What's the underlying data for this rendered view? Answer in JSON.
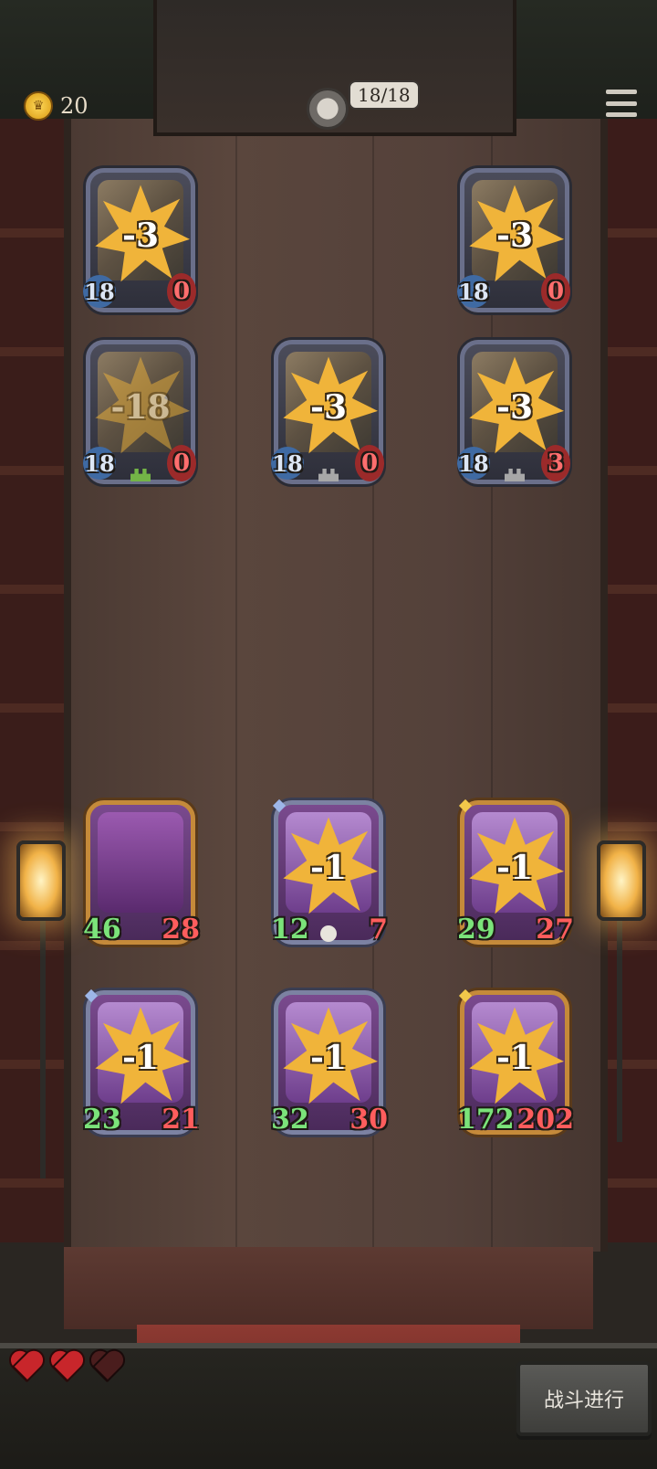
{
  "hud": {
    "gold": "20",
    "turn_counter": "18/18",
    "lives_total": 3,
    "lives_remaining": 2
  },
  "enemy_cards": [
    {
      "attack": "18",
      "health": "0",
      "damage": "-3",
      "faded": false
    },
    {
      "attack": "18",
      "health": "0",
      "damage": "-3",
      "faded": false
    },
    {
      "attack": "18",
      "health": "0",
      "damage": "-18",
      "faded": true
    },
    {
      "attack": "18",
      "health": "0",
      "damage": "-3",
      "faded": false
    },
    {
      "attack": "18",
      "health": "3",
      "damage": "-3",
      "faded": false
    }
  ],
  "ally_cards": [
    {
      "attack": "46",
      "health": "28",
      "damage": ""
    },
    {
      "attack": "12",
      "health": "7",
      "damage": "-1"
    },
    {
      "attack": "29",
      "health": "27",
      "damage": "-1"
    },
    {
      "attack": "23",
      "health": "21",
      "damage": "-1"
    },
    {
      "attack": "32",
      "health": "30",
      "damage": "-1"
    },
    {
      "attack": "172",
      "health": "202",
      "damage": "-1"
    }
  ],
  "battle_button_label": "战斗进行",
  "icons": {
    "gold": "crown-coin-icon",
    "menu": "hamburger-menu-icon",
    "life": "heart-icon"
  },
  "colors": {
    "attack_enemy": "#3f6aa3",
    "health": "#ff5d5d",
    "attack_ally": "#7be37a",
    "damage_star": "#f0b43a"
  }
}
